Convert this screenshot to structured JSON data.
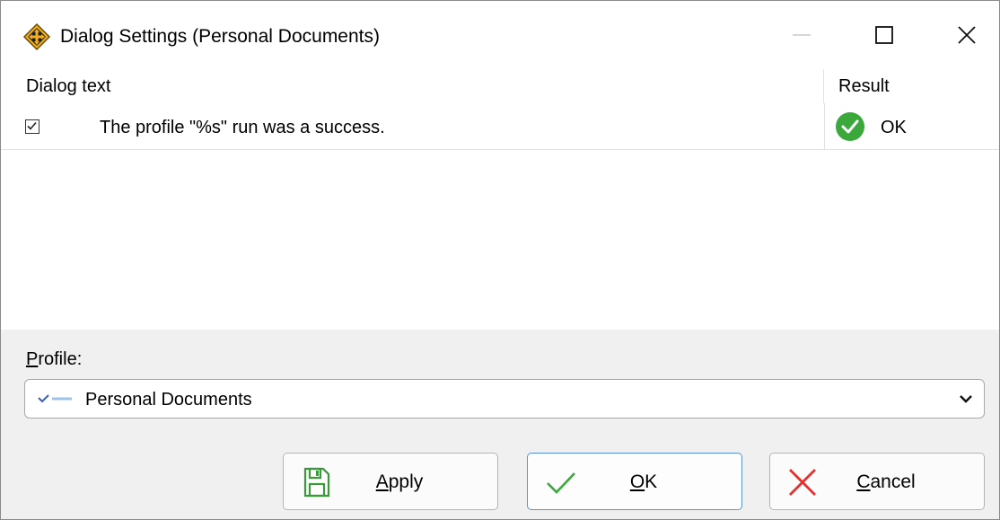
{
  "window": {
    "title": "Dialog Settings (Personal Documents)",
    "controls": {
      "minimize_icon": "minimize-icon",
      "maximize_icon": "maximize-icon",
      "close_icon": "close-icon"
    }
  },
  "list": {
    "columns": {
      "dialog_text": "Dialog text",
      "result": "Result"
    },
    "rows": [
      {
        "checked": true,
        "text": "The profile \"%s\" run was a success.",
        "result": "OK",
        "result_icon": "check-circle-icon"
      }
    ]
  },
  "profile": {
    "label_mnemonic": "P",
    "label_rest": "rofile:",
    "selected_value": "Personal Documents",
    "icon": "profile-check-icon"
  },
  "buttons": {
    "apply": {
      "mnemonic": "A",
      "rest": "pply",
      "icon": "save-icon"
    },
    "ok": {
      "mnemonic": "O",
      "rest": "K",
      "icon": "checkmark-icon"
    },
    "cancel": {
      "mnemonic": "C",
      "rest": "ancel",
      "icon": "cross-icon"
    }
  },
  "colors": {
    "success_green": "#3aa83a",
    "focus_blue": "#5b8fd6",
    "cancel_red": "#e03030",
    "apply_green": "#3a9a3a"
  }
}
